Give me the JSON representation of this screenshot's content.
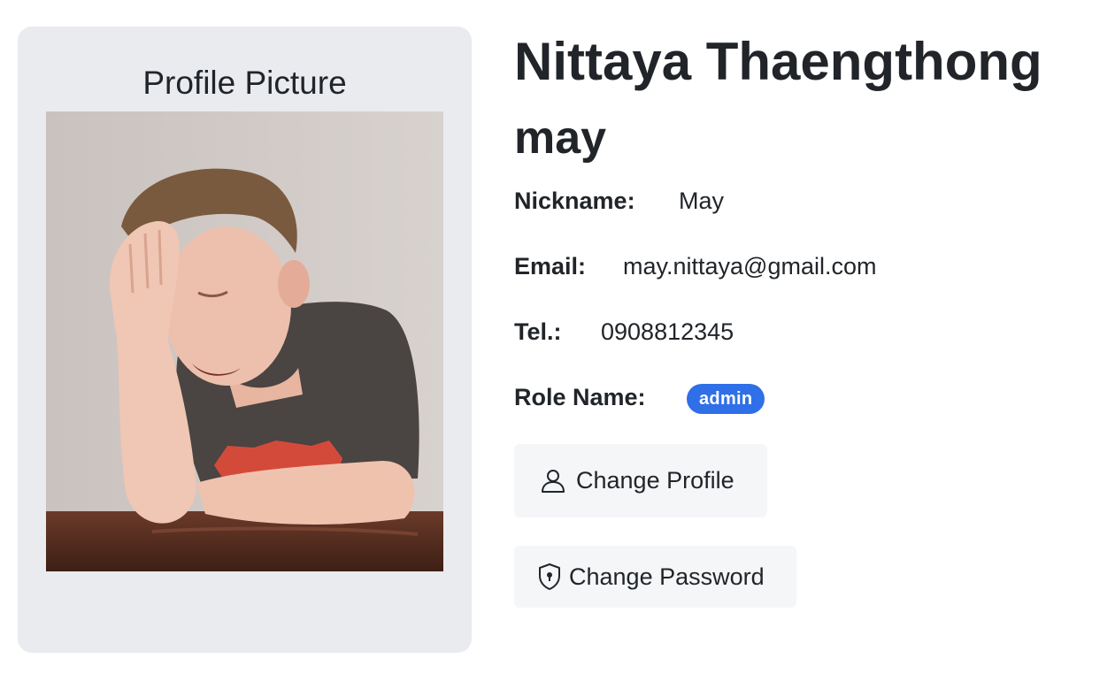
{
  "profile_card": {
    "title": "Profile Picture"
  },
  "user": {
    "full_name": "Nittaya Thaengthong",
    "username": "may"
  },
  "fields": {
    "nickname_label": "Nickname:",
    "nickname_value": "May",
    "email_label": "Email:",
    "email_value": "may.nittaya@gmail.com",
    "tel_label": "Tel.:",
    "tel_value": "0908812345",
    "role_label": "Role Name:",
    "role_value": "admin"
  },
  "buttons": {
    "change_profile": "Change Profile",
    "change_password": "Change Password"
  },
  "icons": {
    "change_profile": "user-icon",
    "change_password": "shield-lock-icon"
  },
  "colors": {
    "card_bg": "#e9ebef",
    "badge_bg": "#2f6fe8",
    "button_bg": "#f5f6f8",
    "text": "#212529"
  }
}
